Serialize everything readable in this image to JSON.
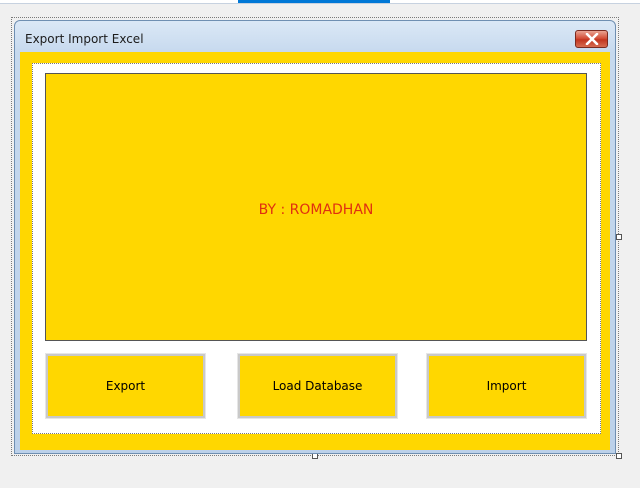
{
  "window": {
    "title": "Export Import Excel",
    "close_icon": "close-icon"
  },
  "content": {
    "credit": "BY : ROMADHAN"
  },
  "buttons": {
    "export": "Export",
    "load_database": "Load Database",
    "import": "Import"
  },
  "colors": {
    "background": "#ffd700",
    "credit_text": "#e03010"
  }
}
